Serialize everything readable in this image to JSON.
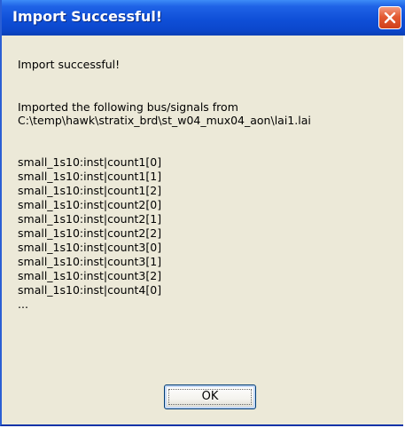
{
  "dialog": {
    "title": "Import Successful!",
    "message": "Import successful!",
    "intro_line": "Imported the following bus/signals from",
    "file_path": "C:\\temp\\hawk\\stratix_brd\\st_w04_mux04_aon\\lai1.lai",
    "signals": [
      "small_1s10:inst|count1[0]",
      "small_1s10:inst|count1[1]",
      "small_1s10:inst|count1[2]",
      "small_1s10:inst|count2[0]",
      "small_1s10:inst|count2[1]",
      "small_1s10:inst|count2[2]",
      "small_1s10:inst|count3[0]",
      "small_1s10:inst|count3[1]",
      "small_1s10:inst|count3[2]",
      "small_1s10:inst|count4[0]"
    ],
    "ellipsis": "...",
    "ok_label": "OK"
  },
  "icons": {
    "close": "close-icon"
  },
  "colors": {
    "titlebar": "#0f4fd8",
    "dialog_background": "#ece9d8",
    "close_button": "#e35a32"
  }
}
